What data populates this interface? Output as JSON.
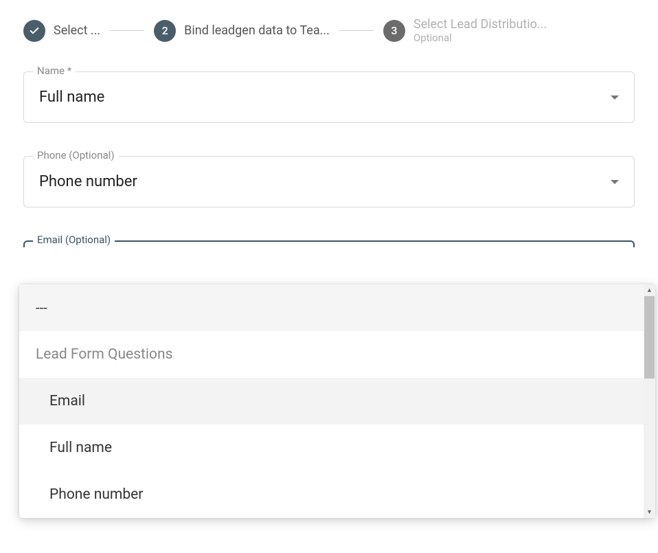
{
  "stepper": {
    "step1": {
      "label": "Select ..."
    },
    "step2": {
      "number": "2",
      "label": "Bind leadgen data to Tea..."
    },
    "step3": {
      "number": "3",
      "title": "Select Lead Distributio...",
      "optional": "Optional"
    }
  },
  "fields": {
    "name": {
      "label": "Name *",
      "value": "Full name"
    },
    "phone": {
      "label": "Phone (Optional)",
      "value": "Phone number"
    },
    "email": {
      "label": "Email (Optional)"
    }
  },
  "dropdown": {
    "blank_option": "---",
    "group_header": "Lead Form Questions",
    "options": {
      "email": "Email",
      "full_name": "Full name",
      "phone_number": "Phone number"
    }
  }
}
